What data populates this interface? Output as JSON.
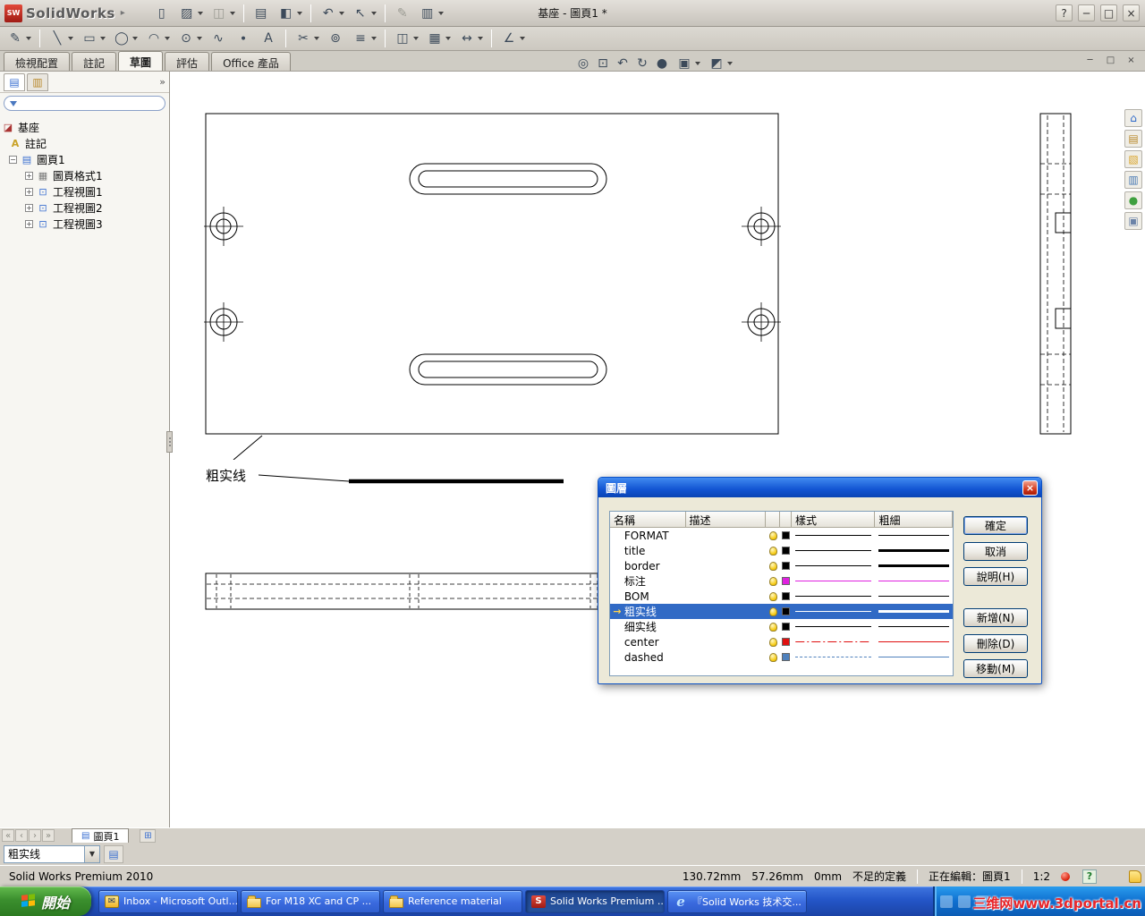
{
  "titlebar": {
    "logo": "SolidWorks",
    "logo_mark": "SW",
    "logo_caret": "▸",
    "title": "基座 - 圖頁1 *",
    "controls": {
      "help": "?",
      "minimize": "─",
      "maximize": "□",
      "close": "×"
    }
  },
  "ribbon": {
    "standard": [
      {
        "name": "new",
        "glyph": "▯"
      },
      {
        "name": "open",
        "glyph": "▨"
      },
      {
        "name": "save",
        "glyph": "◫"
      },
      {
        "name": "print",
        "glyph": "▤"
      },
      {
        "name": "edit-appearance",
        "glyph": "◧"
      },
      {
        "name": "undo",
        "glyph": "↶"
      },
      {
        "name": "select",
        "glyph": "↖"
      },
      {
        "name": "pen",
        "glyph": "✎"
      },
      {
        "name": "options",
        "glyph": "▥"
      }
    ],
    "sketch": [
      {
        "name": "sketch",
        "glyph": "✎"
      },
      {
        "name": "line",
        "glyph": "╲"
      },
      {
        "name": "rectangle",
        "glyph": "▭"
      },
      {
        "name": "circle",
        "glyph": "◯"
      },
      {
        "name": "arc",
        "glyph": "◠"
      },
      {
        "name": "ellipse",
        "glyph": "⊙"
      },
      {
        "name": "spline",
        "glyph": "∿"
      },
      {
        "name": "point",
        "glyph": "∙"
      },
      {
        "name": "text",
        "glyph": "A"
      },
      {
        "name": "trim-entities",
        "glyph": "✂"
      },
      {
        "name": "convert-entities",
        "glyph": "⊚"
      },
      {
        "name": "offset-entities",
        "glyph": "≡"
      },
      {
        "name": "mirror-entities",
        "glyph": "◫"
      },
      {
        "name": "linear-sketch-pattern",
        "glyph": "▦"
      },
      {
        "name": "move-entities",
        "glyph": "↔"
      },
      {
        "name": "quick-snaps",
        "glyph": "∠"
      }
    ],
    "view": [
      {
        "name": "zoom-to-fit",
        "glyph": "◎"
      },
      {
        "name": "zoom-to-area",
        "glyph": "⊡"
      },
      {
        "name": "previous-view",
        "glyph": "↶"
      },
      {
        "name": "rebuild",
        "glyph": "↻"
      },
      {
        "name": "apply-scene",
        "glyph": "●"
      },
      {
        "name": "display-style",
        "glyph": "▣"
      },
      {
        "name": "hide-show-items",
        "glyph": "◩"
      }
    ]
  },
  "tabs": [
    {
      "label": "檢視配置",
      "state": ""
    },
    {
      "label": "註記",
      "state": ""
    },
    {
      "label": "草圖",
      "state": "active"
    },
    {
      "label": "評估",
      "state": ""
    },
    {
      "label": "Office 產品",
      "state": ""
    }
  ],
  "doc_controls": {
    "minimize": "─",
    "restore": "□",
    "close": "×"
  },
  "panel": {
    "expand_glyph": "»",
    "tabs": [
      {
        "name": "featuremanager",
        "glyph": "▤"
      },
      {
        "name": "propertymanager",
        "glyph": "▥"
      }
    ],
    "filter_value": ""
  },
  "feature_tree": {
    "root": {
      "label": "基座",
      "icon": "◪"
    },
    "nodes": [
      {
        "label": "註記",
        "icon": "A",
        "expander": ""
      },
      {
        "label": "圖頁1",
        "icon": "▤",
        "expander": "−"
      },
      {
        "label": "圖頁格式1",
        "icon": "▦",
        "expander": "+"
      },
      {
        "label": "工程視圖1",
        "icon": "⊡",
        "expander": "+"
      },
      {
        "label": "工程視圖2",
        "icon": "⊡",
        "expander": "+"
      },
      {
        "label": "工程視圖3",
        "icon": "⊡",
        "expander": "+"
      }
    ]
  },
  "drawing": {
    "callout": "粗实线"
  },
  "taskpane": [
    {
      "name": "solidworks-resources",
      "glyph": "⌂",
      "color": "#2a67c9"
    },
    {
      "name": "design-library",
      "glyph": "▤",
      "color": "#b98a2d"
    },
    {
      "name": "file-explorer",
      "glyph": "▧",
      "color": "#d9a42a"
    },
    {
      "name": "view-palette",
      "glyph": "▥",
      "color": "#4a7ab5"
    },
    {
      "name": "appearances",
      "glyph": "●",
      "color": "#3fa03f"
    },
    {
      "name": "custom-properties",
      "glyph": "▣",
      "color": "#6b83a8"
    }
  ],
  "layer_dialog": {
    "title": "圖層",
    "close_glyph": "×",
    "columns": {
      "name": "名稱",
      "description": "描述",
      "style": "樣式",
      "thickness": "粗細"
    },
    "rows": [
      {
        "name": "FORMAT",
        "color": "#000000",
        "style": "solid",
        "weight": "thin",
        "state": ""
      },
      {
        "name": "title",
        "color": "#000000",
        "style": "solid",
        "weight": "thick",
        "state": ""
      },
      {
        "name": "border",
        "color": "#000000",
        "style": "solid",
        "weight": "thick",
        "state": ""
      },
      {
        "name": "标注",
        "color": "#e020e0",
        "style": "solid",
        "weight": "thin",
        "state": ""
      },
      {
        "name": "BOM",
        "color": "#000000",
        "style": "solid",
        "weight": "thin",
        "state": ""
      },
      {
        "name": "粗实线",
        "color": "#000000",
        "style": "solid",
        "weight": "thick",
        "state": "selected",
        "marker": "→"
      },
      {
        "name": "细实线",
        "color": "#000000",
        "style": "solid",
        "weight": "thin",
        "state": ""
      },
      {
        "name": "center",
        "color": "#e01010",
        "style": "dashdot",
        "weight": "thin",
        "state": ""
      },
      {
        "name": "dashed",
        "color": "#4f81bd",
        "style": "dashed",
        "weight": "thin",
        "state": ""
      }
    ],
    "buttons": {
      "ok": "確定",
      "cancel": "取消",
      "help": "說明(H)",
      "new": "新增(N)",
      "delete": "刪除(D)",
      "move": "移動(M)"
    }
  },
  "sheet_bar": {
    "nav": [
      {
        "name": "first-sheet",
        "glyph": "«"
      },
      {
        "name": "prev-sheet",
        "glyph": "‹"
      },
      {
        "name": "next-sheet",
        "glyph": "›"
      },
      {
        "name": "last-sheet",
        "glyph": "»"
      }
    ],
    "tab": "圖頁1",
    "tab_icon": "▤",
    "add_glyph": "⊞"
  },
  "layer_toolbar": {
    "current_layer": "粗实线",
    "arrow": "▼",
    "props_glyph": "▤"
  },
  "statusbar": {
    "app": "Solid Works Premium 2010",
    "x": "130.72mm",
    "y": "57.26mm",
    "z": "0mm",
    "state": "不足的定義",
    "editing": "正在編輯：圖頁1",
    "scale": "1:2",
    "help_glyph": "?"
  },
  "taskbar": {
    "start_label": "開始",
    "buttons": [
      {
        "label": "Inbox - Microsoft Outl...",
        "state": ""
      },
      {
        "label": "For M18 XC and CP ...",
        "state": ""
      },
      {
        "label": "Reference material",
        "state": ""
      },
      {
        "label": "Solid Works Premium ...",
        "state": "active"
      },
      {
        "label": "『Solid Works 技术交...",
        "state": ""
      }
    ],
    "sw_icon_letter": "S",
    "ie_icon_letter": "e",
    "outlook_icon_glyph": "✉",
    "watermark": "三维网www.3dportal.cn"
  }
}
